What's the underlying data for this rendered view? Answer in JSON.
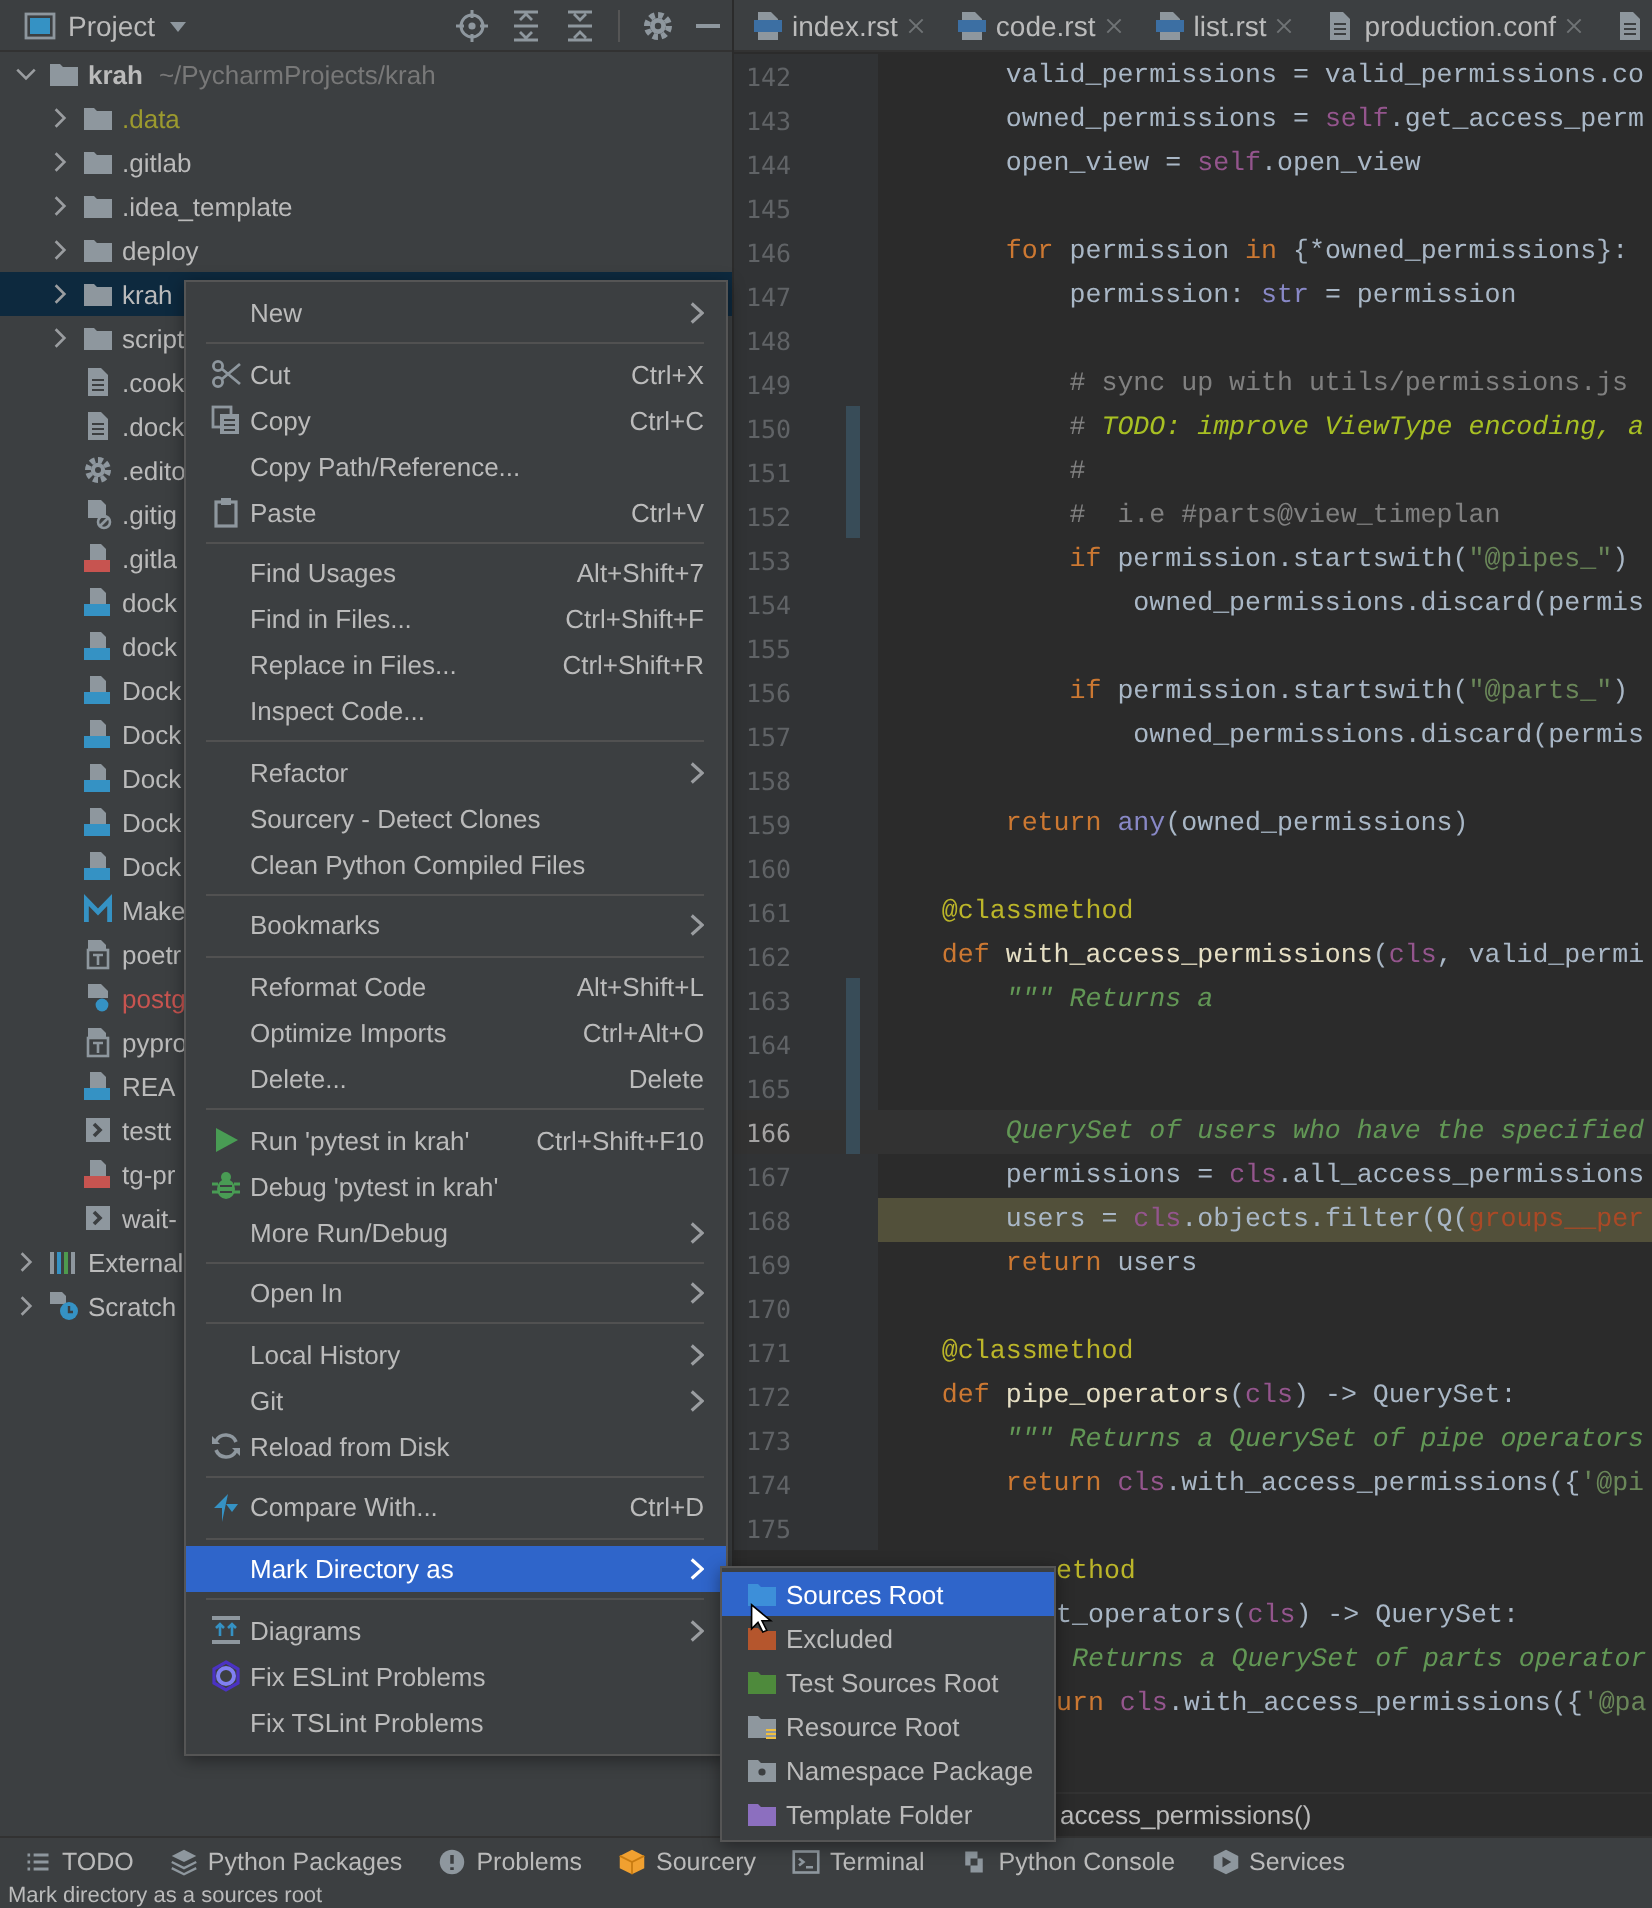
{
  "project_panel": {
    "title": "Project"
  },
  "tree": [
    {
      "label": "krah",
      "detail": "~/PycharmProjects/krah",
      "kind": "folder",
      "expanded": true,
      "selected": false,
      "color": "#bbbbbb",
      "children": [
        {
          "label": ".data",
          "kind": "folder",
          "expanded": false,
          "selected": false,
          "color": "#9c9a2e"
        },
        {
          "label": ".gitlab",
          "kind": "folder",
          "expanded": false,
          "selected": false,
          "color": "#bbbbbb"
        },
        {
          "label": ".idea_template",
          "kind": "folder",
          "expanded": false,
          "selected": false,
          "color": "#bbbbbb"
        },
        {
          "label": "deploy",
          "kind": "folder",
          "expanded": false,
          "selected": false,
          "color": "#bbbbbb"
        },
        {
          "label": "krah",
          "kind": "folder",
          "expanded": false,
          "selected": true,
          "color": "#bbbbbb"
        },
        {
          "label": "script",
          "kind": "folder",
          "expanded": false,
          "selected": false,
          "color": "#bbbbbb"
        },
        {
          "label": ".cook",
          "kind": "text-file",
          "selected": false,
          "color": "#bbbbbb"
        },
        {
          "label": ".dock",
          "kind": "text-file",
          "selected": false,
          "color": "#bbbbbb"
        },
        {
          "label": ".edito",
          "kind": "settings-file",
          "selected": false,
          "color": "#bbbbbb"
        },
        {
          "label": ".gitig",
          "kind": "ignore-file",
          "selected": false,
          "color": "#bbbbbb"
        },
        {
          "label": ".gitla",
          "kind": "yml-file",
          "selected": false,
          "color": "#bbbbbb"
        },
        {
          "label": "dock",
          "kind": "compose-file",
          "selected": false,
          "color": "#bbbbbb"
        },
        {
          "label": "dock",
          "kind": "compose-file",
          "selected": false,
          "color": "#bbbbbb"
        },
        {
          "label": "Dock",
          "kind": "docker-file",
          "selected": false,
          "color": "#bbbbbb"
        },
        {
          "label": "Dock",
          "kind": "docker-file",
          "selected": false,
          "color": "#bbbbbb"
        },
        {
          "label": "Dock",
          "kind": "docker-file",
          "selected": false,
          "color": "#bbbbbb"
        },
        {
          "label": "Dock",
          "kind": "docker-file",
          "selected": false,
          "color": "#bbbbbb"
        },
        {
          "label": "Dock",
          "kind": "docker-file",
          "selected": false,
          "color": "#bbbbbb"
        },
        {
          "label": "Make",
          "kind": "makefile",
          "selected": false,
          "color": "#bbbbbb"
        },
        {
          "label": "poetr",
          "kind": "toml-file",
          "selected": false,
          "color": "#bbbbbb"
        },
        {
          "label": "postg",
          "kind": "unknown-file",
          "selected": false,
          "color": "#c75450"
        },
        {
          "label": "pypro",
          "kind": "toml-file",
          "selected": false,
          "color": "#bbbbbb"
        },
        {
          "label": "REA",
          "kind": "md-file",
          "selected": false,
          "color": "#bbbbbb"
        },
        {
          "label": "testt",
          "kind": "script-file",
          "selected": false,
          "color": "#bbbbbb"
        },
        {
          "label": "tg-pr",
          "kind": "yml-file",
          "selected": false,
          "color": "#bbbbbb"
        },
        {
          "label": "wait-",
          "kind": "script-file",
          "selected": false,
          "color": "#bbbbbb"
        }
      ]
    },
    {
      "label": "External",
      "kind": "libraries",
      "expanded": false,
      "selected": false,
      "color": "#bbbbbb"
    },
    {
      "label": "Scratch",
      "kind": "scratches",
      "expanded": false,
      "selected": false,
      "color": "#bbbbbb"
    }
  ],
  "editor_tabs": [
    {
      "label": "index.rst",
      "kind": "rst",
      "selected": false
    },
    {
      "label": "code.rst",
      "kind": "rst",
      "selected": false
    },
    {
      "label": "list.rst",
      "kind": "rst",
      "selected": false
    },
    {
      "label": "production.conf",
      "kind": "conf",
      "selected": false
    },
    {
      "kind": "conf",
      "selected": false
    }
  ],
  "code_lines": [
    {
      "number": "142",
      "kind": "normal",
      "changed": false,
      "tokens": [
        {
          "kind": "plain",
          "text": "        valid_permissions = valid_permissions.co"
        }
      ]
    },
    {
      "number": "143",
      "kind": "normal",
      "changed": false,
      "tokens": [
        {
          "kind": "plain",
          "text": "        owned_permissions = "
        },
        {
          "kind": "self",
          "text": "self"
        },
        {
          "kind": "plain",
          "text": ".get_access_perm"
        }
      ]
    },
    {
      "number": "144",
      "kind": "normal",
      "changed": false,
      "tokens": [
        {
          "kind": "plain",
          "text": "        open_view = "
        },
        {
          "kind": "self",
          "text": "self"
        },
        {
          "kind": "plain",
          "text": ".open_view"
        }
      ]
    },
    {
      "number": "145",
      "kind": "normal",
      "changed": false
    },
    {
      "number": "146",
      "kind": "normal",
      "changed": false,
      "tokens": [
        {
          "kind": "keyword",
          "text": "        for"
        },
        {
          "kind": "plain",
          "text": " permission "
        },
        {
          "kind": "keyword",
          "text": "in"
        },
        {
          "kind": "plain",
          "text": " {*owned_permissions}:"
        }
      ]
    },
    {
      "number": "147",
      "kind": "normal",
      "changed": false,
      "tokens": [
        {
          "kind": "plain",
          "text": "            permission: "
        },
        {
          "kind": "builtin",
          "text": "str"
        },
        {
          "kind": "plain",
          "text": " = permission"
        }
      ]
    },
    {
      "number": "148",
      "kind": "normal",
      "changed": false
    },
    {
      "number": "149",
      "kind": "normal",
      "changed": false,
      "tokens": [
        {
          "kind": "comment",
          "text": "            # sync up with utils/permissions.js"
        }
      ]
    },
    {
      "number": "150",
      "kind": "normal",
      "changed": true,
      "tokens": [
        {
          "kind": "comment",
          "text": "            #"
        },
        {
          "kind": "todo",
          "text": " TODO: improve ViewType encoding, a"
        }
      ]
    },
    {
      "number": "151",
      "kind": "normal",
      "changed": true,
      "tokens": [
        {
          "kind": "comment",
          "text": "            #"
        }
      ]
    },
    {
      "number": "152",
      "kind": "normal",
      "changed": true,
      "tokens": [
        {
          "kind": "comment",
          "text": "            #  i.e #parts@view_timeplan"
        }
      ]
    },
    {
      "number": "153",
      "kind": "normal",
      "changed": false,
      "tokens": [
        {
          "kind": "keyword",
          "text": "            if"
        },
        {
          "kind": "plain",
          "text": " permission.startswith("
        },
        {
          "kind": "string",
          "text": "\"@pipes_\""
        },
        {
          "kind": "plain",
          "text": ")"
        }
      ]
    },
    {
      "number": "154",
      "kind": "normal",
      "changed": false,
      "tokens": [
        {
          "kind": "plain",
          "text": "                owned_permissions.discard(permis"
        }
      ]
    },
    {
      "number": "155",
      "kind": "normal",
      "changed": false
    },
    {
      "number": "156",
      "kind": "normal",
      "changed": false,
      "tokens": [
        {
          "kind": "keyword",
          "text": "            if"
        },
        {
          "kind": "plain",
          "text": " permission.startswith("
        },
        {
          "kind": "string",
          "text": "\"@parts_\""
        },
        {
          "kind": "plain",
          "text": ")"
        }
      ]
    },
    {
      "number": "157",
      "kind": "normal",
      "changed": false,
      "tokens": [
        {
          "kind": "plain",
          "text": "                owned_permissions.discard(permis"
        }
      ]
    },
    {
      "number": "158",
      "kind": "normal",
      "changed": false
    },
    {
      "number": "159",
      "kind": "normal",
      "changed": false,
      "tokens": [
        {
          "kind": "keyword",
          "text": "        return"
        },
        {
          "kind": "builtin",
          "text": " any"
        },
        {
          "kind": "plain",
          "text": "(owned_permissions)"
        }
      ]
    },
    {
      "number": "160",
      "kind": "normal",
      "changed": false
    },
    {
      "number": "161",
      "kind": "normal",
      "changed": false,
      "tokens": [
        {
          "kind": "decorator",
          "text": "    @classmethod"
        }
      ]
    },
    {
      "number": "162",
      "kind": "normal",
      "changed": false,
      "tokens": [
        {
          "kind": "keyword",
          "text": "    def"
        },
        {
          "kind": "function",
          "text": " with_access_permissions"
        },
        {
          "kind": "plain",
          "text": "("
        },
        {
          "kind": "self",
          "text": "cls"
        },
        {
          "kind": "plain",
          "text": ", valid_permi"
        }
      ]
    },
    {
      "number": "163",
      "kind": "normal",
      "changed": true,
      "tokens": [
        {
          "kind": "docstring",
          "text": "        \"\"\" Returns a"
        }
      ]
    },
    {
      "number": "164",
      "kind": "normal",
      "changed": true
    },
    {
      "number": "165",
      "kind": "normal",
      "changed": true
    },
    {
      "number": "166",
      "kind": "current",
      "changed": true,
      "tokens": [
        {
          "kind": "docstring",
          "text": "        QuerySet of users who have the specified"
        }
      ]
    },
    {
      "number": "167",
      "kind": "normal",
      "changed": false,
      "tokens": [
        {
          "kind": "plain",
          "text": "        permissions = "
        },
        {
          "kind": "self",
          "text": "cls"
        },
        {
          "kind": "plain",
          "text": ".all_access_permissions"
        }
      ]
    },
    {
      "number": "168",
      "kind": "highlighted",
      "changed": false,
      "tokens": [
        {
          "kind": "plain",
          "text": "        users = "
        },
        {
          "kind": "self",
          "text": "cls"
        },
        {
          "kind": "plain",
          "text": ".objects.filter(Q("
        },
        {
          "kind": "keyword_arg",
          "text": "groups__per"
        }
      ]
    },
    {
      "number": "169",
      "kind": "normal",
      "changed": false,
      "tokens": [
        {
          "kind": "keyword",
          "text": "        return"
        },
        {
          "kind": "plain",
          "text": " users"
        }
      ]
    },
    {
      "number": "170",
      "kind": "normal",
      "changed": false
    },
    {
      "number": "171",
      "kind": "normal",
      "changed": false,
      "tokens": [
        {
          "kind": "decorator",
          "text": "    @classmethod"
        }
      ]
    },
    {
      "number": "172",
      "kind": "normal",
      "changed": false,
      "tokens": [
        {
          "kind": "keyword",
          "text": "    def"
        },
        {
          "kind": "function",
          "text": " pipe_operators"
        },
        {
          "kind": "plain",
          "text": "("
        },
        {
          "kind": "self",
          "text": "cls"
        },
        {
          "kind": "plain",
          "text": ") -> QuerySet:"
        }
      ]
    },
    {
      "number": "173",
      "kind": "normal",
      "changed": false,
      "tokens": [
        {
          "kind": "docstring",
          "text": "        \"\"\" Returns a QuerySet of pipe operators"
        }
      ]
    },
    {
      "number": "174",
      "kind": "normal",
      "changed": false,
      "tokens": [
        {
          "kind": "keyword",
          "text": "        return"
        },
        {
          "kind": "self",
          "text": " cls"
        },
        {
          "kind": "plain",
          "text": ".with_access_permissions({"
        },
        {
          "kind": "string",
          "text": "'@pi"
        }
      ]
    },
    {
      "number": "175",
      "kind": "normal",
      "changed": false
    },
    {
      "kind": "normal",
      "tokens": [
        {
          "kind": "decorator",
          "text": "ethod"
        }
      ]
    },
    {
      "kind": "normal",
      "tokens": [
        {
          "kind": "plain",
          "text": "t_operators("
        },
        {
          "kind": "self",
          "text": "cls"
        },
        {
          "kind": "plain",
          "text": ") -> QuerySet:"
        }
      ]
    },
    {
      "kind": "normal",
      "tokens": [
        {
          "kind": "docstring",
          "text": " Returns a QuerySet of parts operator"
        }
      ]
    },
    {
      "kind": "normal",
      "tokens": [
        {
          "kind": "keyword",
          "text": "urn"
        },
        {
          "kind": "self",
          "text": " cls"
        },
        {
          "kind": "plain",
          "text": ".with_access_permissions({"
        },
        {
          "kind": "string",
          "text": "'@pa"
        }
      ]
    }
  ],
  "breadcrumb": "access_permissions()",
  "context_menu": {
    "items": [
      {
        "kind": "item",
        "label": "New",
        "submenu": true,
        "selected": false
      },
      {
        "kind": "separator"
      },
      {
        "kind": "item",
        "label": "Cut",
        "shortcut": "Ctrl+X",
        "submenu": false,
        "selected": false
      },
      {
        "kind": "item",
        "label": "Copy",
        "shortcut": "Ctrl+C",
        "submenu": false,
        "selected": false
      },
      {
        "kind": "item",
        "label": "Copy Path/Reference...",
        "submenu": false,
        "selected": false
      },
      {
        "kind": "item",
        "label": "Paste",
        "shortcut": "Ctrl+V",
        "submenu": false,
        "selected": false
      },
      {
        "kind": "separator"
      },
      {
        "kind": "item",
        "label": "Find Usages",
        "shortcut": "Alt+Shift+7",
        "submenu": false,
        "selected": false
      },
      {
        "kind": "item",
        "label": "Find in Files...",
        "shortcut": "Ctrl+Shift+F",
        "submenu": false,
        "selected": false
      },
      {
        "kind": "item",
        "label": "Replace in Files...",
        "shortcut": "Ctrl+Shift+R",
        "submenu": false,
        "selected": false
      },
      {
        "kind": "item",
        "label": "Inspect Code...",
        "submenu": false,
        "selected": false
      },
      {
        "kind": "separator"
      },
      {
        "kind": "item",
        "label": "Refactor",
        "submenu": true,
        "selected": false
      },
      {
        "kind": "item",
        "label": "Sourcery - Detect Clones",
        "submenu": false,
        "selected": false
      },
      {
        "kind": "item",
        "label": "Clean Python Compiled Files",
        "submenu": false,
        "selected": false
      },
      {
        "kind": "separator"
      },
      {
        "kind": "item",
        "label": "Bookmarks",
        "submenu": true,
        "selected": false
      },
      {
        "kind": "separator"
      },
      {
        "kind": "item",
        "label": "Reformat Code",
        "shortcut": "Alt+Shift+L",
        "submenu": false,
        "selected": false
      },
      {
        "kind": "item",
        "label": "Optimize Imports",
        "shortcut": "Ctrl+Alt+O",
        "submenu": false,
        "selected": false
      },
      {
        "kind": "item",
        "label": "Delete...",
        "shortcut": "Delete",
        "submenu": false,
        "selected": false
      },
      {
        "kind": "separator"
      },
      {
        "kind": "item",
        "label": "Run 'pytest in krah'",
        "shortcut": "Ctrl+Shift+F10",
        "submenu": false,
        "selected": false
      },
      {
        "kind": "item",
        "label": "Debug 'pytest in krah'",
        "submenu": false,
        "selected": false
      },
      {
        "kind": "item",
        "label": "More Run/Debug",
        "submenu": true,
        "selected": false
      },
      {
        "kind": "separator"
      },
      {
        "kind": "item",
        "label": "Open In",
        "submenu": true,
        "selected": false
      },
      {
        "kind": "separator"
      },
      {
        "kind": "item",
        "label": "Local History",
        "submenu": true,
        "selected": false
      },
      {
        "kind": "item",
        "label": "Git",
        "submenu": true,
        "selected": false
      },
      {
        "kind": "item",
        "label": "Reload from Disk",
        "submenu": false,
        "selected": false
      },
      {
        "kind": "separator"
      },
      {
        "kind": "item",
        "label": "Compare With...",
        "shortcut": "Ctrl+D",
        "submenu": false,
        "selected": false
      },
      {
        "kind": "separator"
      },
      {
        "kind": "item",
        "label": "Mark Directory as",
        "submenu": true,
        "selected": true
      },
      {
        "kind": "separator"
      },
      {
        "kind": "item",
        "label": "Diagrams",
        "submenu": true,
        "selected": false
      },
      {
        "kind": "item",
        "label": "Fix ESLint Problems",
        "submenu": false,
        "selected": false
      },
      {
        "kind": "item",
        "label": "Fix TSLint Problems",
        "submenu": false,
        "selected": false
      }
    ]
  },
  "submenu": {
    "items": [
      {
        "label": "Sources Root",
        "color": "#3d8fd9",
        "selected": true
      },
      {
        "label": "Excluded",
        "color": "#b5562d",
        "selected": false
      },
      {
        "label": "Test Sources Root",
        "color": "#4e8a3c",
        "selected": false
      },
      {
        "label": "Resource Root",
        "color": "#8e979e",
        "selected": false
      },
      {
        "label": "Namespace Package",
        "color": "#8e979e",
        "selected": false
      },
      {
        "label": "Template Folder",
        "color": "#8c6fbf",
        "selected": false
      }
    ]
  },
  "tool_windows": [
    {
      "label": "TODO"
    },
    {
      "label": "Python Packages"
    },
    {
      "label": "Problems"
    },
    {
      "label": "Sourcery"
    },
    {
      "label": "Terminal"
    },
    {
      "label": "Python Console"
    },
    {
      "label": "Services"
    }
  ],
  "status_bar": "Mark directory as a sources root"
}
